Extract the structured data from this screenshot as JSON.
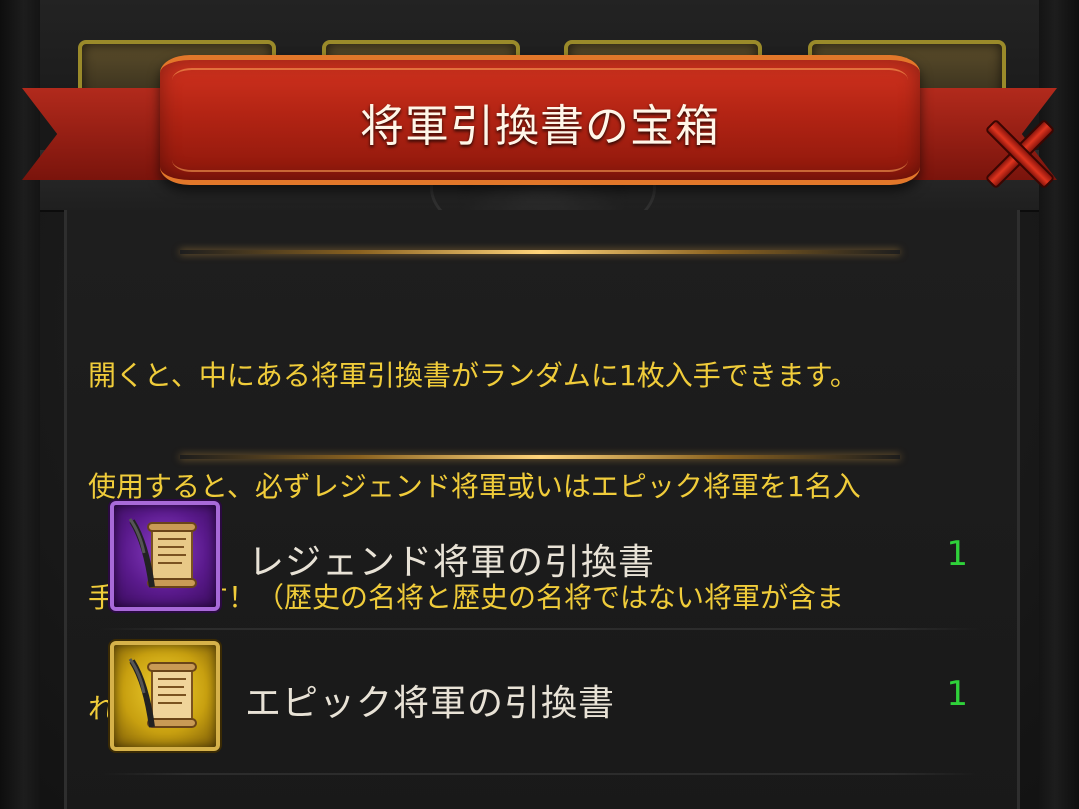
{
  "dialog": {
    "title": "将軍引換書の宝箱",
    "description_lines": [
      "開くと、中にある将軍引換書がランダムに1枚入手できます。",
      "使用すると、必ずレジェンド将軍或いはエピック将軍を1名入",
      "手できます！（歴史の名将と歴史の名将ではない将軍が含ま",
      "れます）"
    ]
  },
  "rewards": [
    {
      "name": "レジェンド将軍の引換書",
      "quantity": "1",
      "rarity": "legend",
      "icon": "legend-scroll-icon"
    },
    {
      "name": "エピック将軍の引換書",
      "quantity": "1",
      "rarity": "epic",
      "icon": "epic-scroll-icon"
    }
  ],
  "colors": {
    "ribbon": "#b32414",
    "description_text": "#f0cc3a",
    "quantity_text": "#2fd13a",
    "legend_frame": "#a86ad8",
    "epic_frame": "#d6b24a"
  }
}
